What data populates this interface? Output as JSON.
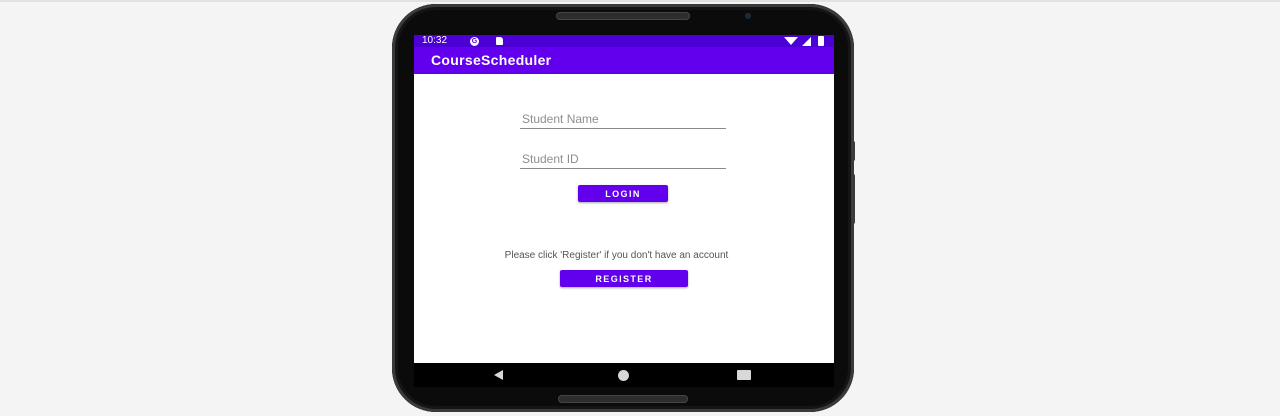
{
  "status_bar": {
    "time": "10:32",
    "icons": [
      "google-icon",
      "sd-card-icon",
      "wifi-icon",
      "signal-icon",
      "battery-icon"
    ]
  },
  "app_bar": {
    "title": "CourseScheduler"
  },
  "form": {
    "student_name_placeholder": "Student Name",
    "student_id_placeholder": "Student ID",
    "login_label": "LOGIN"
  },
  "register_section": {
    "hint": "Please click 'Register' if you don't have an account",
    "register_label": "REGISTER"
  },
  "nav_bar": {
    "icons": [
      "back-icon",
      "home-icon",
      "recents-icon"
    ]
  },
  "colors": {
    "primary": "#6200ee",
    "primary_dark": "#4c00d6",
    "background": "#f4f4f4"
  }
}
